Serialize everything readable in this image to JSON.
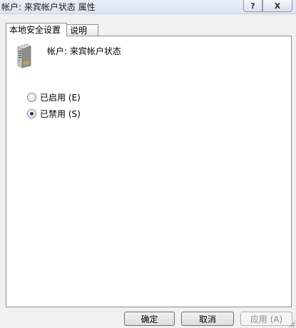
{
  "window": {
    "title": "帐户: 来宾帐户状态 属性",
    "help_button": "?",
    "close_button": "X"
  },
  "tabs": [
    {
      "label": "本地安全设置",
      "active": true
    },
    {
      "label": "说明",
      "active": false
    }
  ],
  "panel": {
    "icon": "server-icon",
    "heading": "帐户: 来宾帐户状态",
    "options": [
      {
        "label": "已启用 (E)",
        "checked": false
      },
      {
        "label": "已禁用 (S)",
        "checked": true
      }
    ]
  },
  "buttons": {
    "ok": "确定",
    "cancel": "取消",
    "apply": "应用 (A)"
  }
}
